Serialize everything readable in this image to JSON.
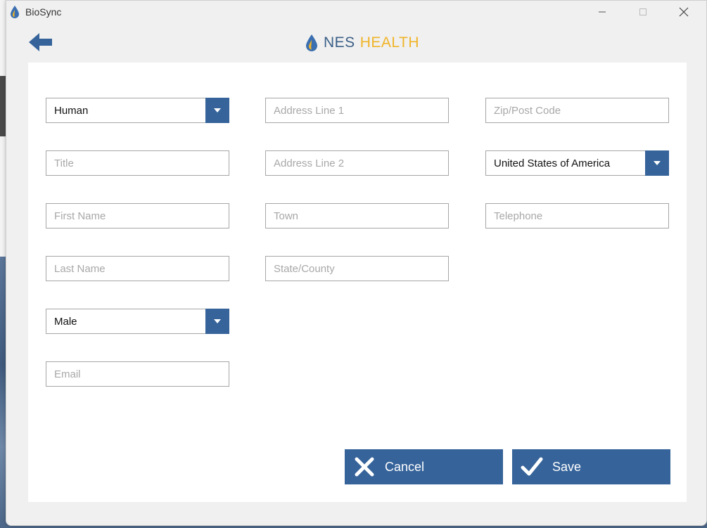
{
  "window": {
    "title": "BioSync",
    "logo_nes": "NES",
    "logo_health": "HEALTH"
  },
  "form": {
    "species": "Human",
    "title_placeholder": "Title",
    "first_name_placeholder": "First Name",
    "last_name_placeholder": "Last Name",
    "gender": "Male",
    "email_placeholder": "Email",
    "address1_placeholder": "Address Line 1",
    "address2_placeholder": "Address Line 2",
    "town_placeholder": "Town",
    "state_placeholder": "State/County",
    "zip_placeholder": "Zip/Post Code",
    "country": "United States of America",
    "telephone_placeholder": "Telephone"
  },
  "actions": {
    "cancel_label": "Cancel",
    "save_label": "Save"
  },
  "colors": {
    "accent": "#35639a",
    "logo_blue": "#3b5f87",
    "logo_gold": "#f0b429"
  }
}
